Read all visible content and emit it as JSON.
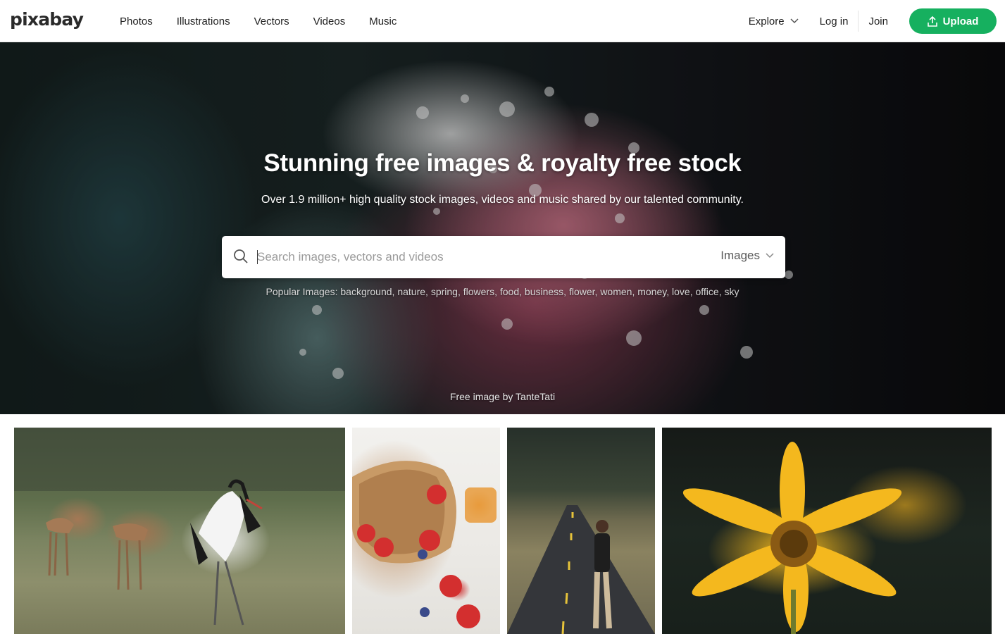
{
  "brand": {
    "logo_text": "pixabay",
    "accent_color": "#16b05f"
  },
  "nav": {
    "links": [
      "Photos",
      "Illustrations",
      "Vectors",
      "Videos",
      "Music"
    ],
    "explore_label": "Explore",
    "login_label": "Log in",
    "join_label": "Join",
    "upload_label": "Upload",
    "icons": {
      "explore": "chevron-down-icon",
      "upload": "upload-icon"
    }
  },
  "hero": {
    "title": "Stunning free images & royalty free stock",
    "subtitle": "Over 1.9 million+ high quality stock images, videos and music shared by our talented community.",
    "search": {
      "placeholder": "Search images, vectors and videos",
      "value": "",
      "type_selected": "Images",
      "icon": "search-icon"
    },
    "popular_label": "Popular Images:",
    "popular_tags": [
      "background",
      "nature",
      "spring",
      "flowers",
      "food",
      "business",
      "flower",
      "women",
      "money",
      "love",
      "office",
      "sky"
    ],
    "credit": "Free image by TanteTati"
  },
  "gallery": {
    "images": [
      "deer-and-crane-photo",
      "strawberries-tray-photo",
      "man-on-road-photo",
      "yellow-flower-photo"
    ]
  }
}
